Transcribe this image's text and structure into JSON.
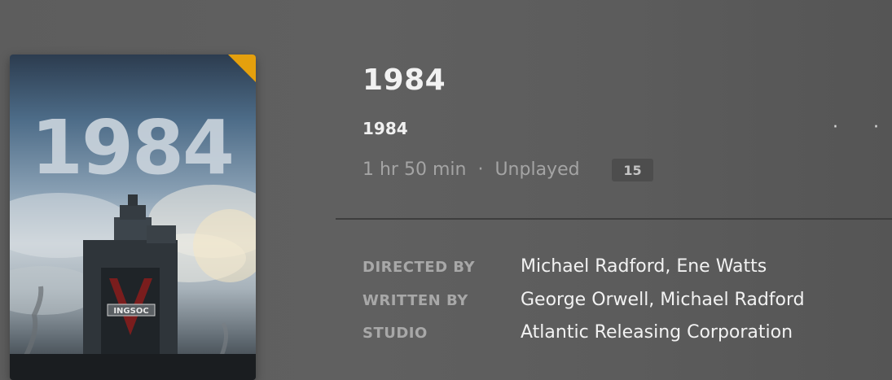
{
  "poster": {
    "title_art": "1984",
    "emblem_text": "INGSOC",
    "corner_badge_color": "#e5a00d"
  },
  "header": {
    "title": "1984",
    "subtitle": "1984",
    "more_label": "· · ·"
  },
  "meta": {
    "duration": "1 hr 50 min",
    "separator": "·",
    "status": "Unplayed",
    "rating": "15"
  },
  "credits": [
    {
      "label": "DIRECTED BY",
      "value": "Michael Radford, Ene Watts"
    },
    {
      "label": "WRITTEN BY",
      "value": "George Orwell, Michael Radford"
    },
    {
      "label": "STUDIO",
      "value": "Atlantic Releasing Corporation"
    }
  ]
}
